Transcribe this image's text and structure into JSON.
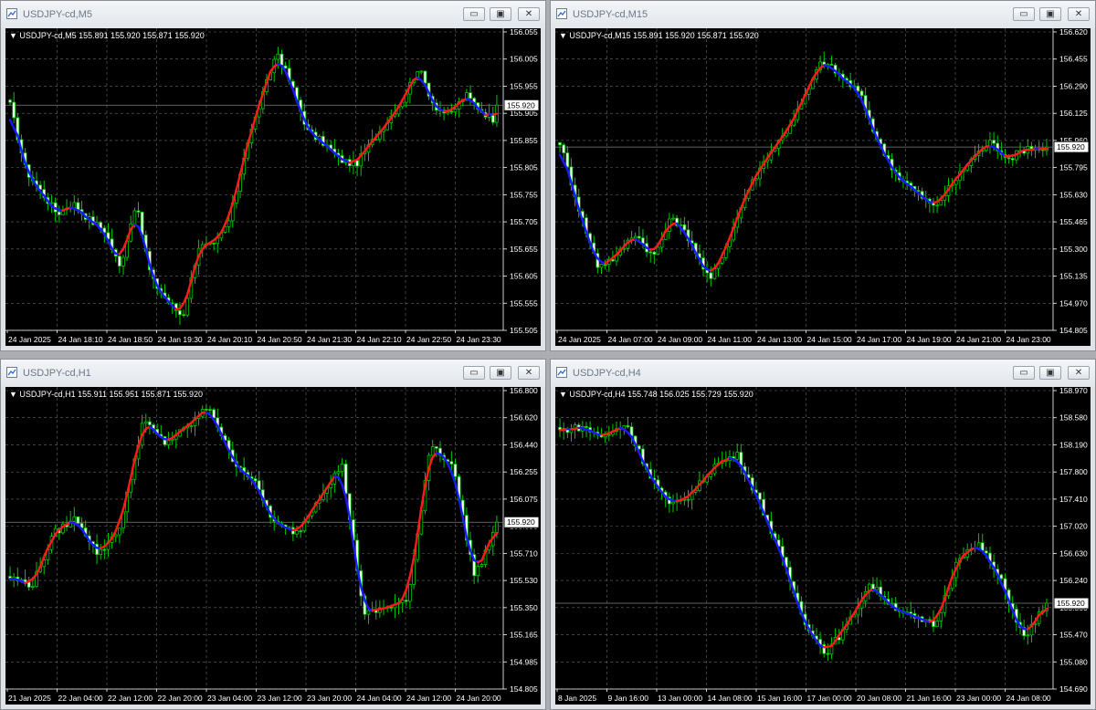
{
  "colors": {
    "bull": "#00c800",
    "bear": "#00c800",
    "up_line": "#ff1a1a",
    "down_line": "#1a1aff",
    "grid": "#6a6a6a",
    "axis_text": "#ffffff",
    "bid_line": "#808080"
  },
  "window_buttons": {
    "minimize": "▭",
    "maximize": "▣",
    "close": "✕"
  },
  "charts": [
    {
      "window_title": "USDJPY-cd,M5",
      "info": "▼ USDJPY-cd,M5  155.891 155.920 155.871 155.920",
      "price_label": "155.920",
      "y_ticks": [
        "156.055",
        "156.005",
        "155.955",
        "155.905",
        "155.855",
        "155.805",
        "155.755",
        "155.705",
        "155.655",
        "155.605",
        "155.555",
        "155.505"
      ],
      "x_ticks": [
        "24 Jan 2025",
        "24 Jan 18:10",
        "24 Jan 18:50",
        "24 Jan 19:30",
        "24 Jan 20:10",
        "24 Jan 20:50",
        "24 Jan 21:30",
        "24 Jan 22:10",
        "24 Jan 22:50",
        "24 Jan 23:30"
      ],
      "chart_data": {
        "type": "candlestick",
        "symbol": "USDJPY-cd",
        "timeframe": "M5",
        "last": 155.92,
        "ylim": [
          155.505,
          156.055
        ],
        "close": [
          155.92,
          155.8,
          155.76,
          155.72,
          155.74,
          155.71,
          155.69,
          155.62,
          155.74,
          155.6,
          155.56,
          155.53,
          155.66,
          155.66,
          155.71,
          155.84,
          155.93,
          156.02,
          155.95,
          155.87,
          155.85,
          155.82,
          155.81,
          155.85,
          155.89,
          155.93,
          155.99,
          155.92,
          155.9,
          155.94,
          155.91,
          155.89
        ]
      }
    },
    {
      "window_title": "USDJPY-cd,M15",
      "info": "▼ USDJPY-cd,M15  155.891 155.920 155.871 155.920",
      "price_label": "155.920",
      "y_ticks": [
        "156.620",
        "156.455",
        "156.290",
        "156.125",
        "155.960",
        "155.795",
        "155.630",
        "155.465",
        "155.300",
        "155.135",
        "154.970",
        "154.805"
      ],
      "x_ticks": [
        "24 Jan 2025",
        "24 Jan 07:00",
        "24 Jan 09:00",
        "24 Jan 11:00",
        "24 Jan 13:00",
        "24 Jan 15:00",
        "24 Jan 17:00",
        "24 Jan 19:00",
        "24 Jan 21:00",
        "24 Jan 23:00"
      ],
      "chart_data": {
        "type": "candlestick",
        "symbol": "USDJPY-cd",
        "timeframe": "M15",
        "last": 155.92,
        "ylim": [
          154.805,
          156.62
        ],
        "close": [
          155.95,
          155.55,
          155.2,
          155.25,
          155.4,
          155.25,
          155.5,
          155.35,
          155.1,
          155.35,
          155.65,
          155.85,
          156.0,
          156.2,
          156.45,
          156.35,
          156.25,
          155.95,
          155.75,
          155.65,
          155.55,
          155.7,
          155.85,
          155.95,
          155.85,
          155.92,
          155.9
        ]
      }
    },
    {
      "window_title": "USDJPY-cd,H1",
      "info": "▼ USDJPY-cd,H1  155.911 155.951 155.871 155.920",
      "price_label": "155.920",
      "y_ticks": [
        "156.800",
        "156.620",
        "156.440",
        "156.255",
        "156.075",
        "155.890",
        "155.710",
        "155.530",
        "155.350",
        "155.165",
        "154.985",
        "154.805"
      ],
      "x_ticks": [
        "21 Jan 2025",
        "22 Jan 04:00",
        "22 Jan 12:00",
        "22 Jan 20:00",
        "23 Jan 04:00",
        "23 Jan 12:00",
        "23 Jan 20:00",
        "24 Jan 04:00",
        "24 Jan 12:00",
        "24 Jan 20:00"
      ],
      "chart_data": {
        "type": "candlestick",
        "symbol": "USDJPY-cd",
        "timeframe": "H1",
        "last": 155.92,
        "ylim": [
          154.805,
          156.8
        ],
        "close": [
          155.55,
          155.5,
          155.85,
          155.95,
          155.7,
          155.9,
          156.6,
          156.45,
          156.55,
          156.7,
          156.35,
          156.2,
          155.9,
          155.85,
          156.1,
          156.3,
          155.3,
          155.35,
          155.4,
          156.45,
          156.3,
          155.55,
          155.9
        ]
      }
    },
    {
      "window_title": "USDJPY-cd,H4",
      "info": "▼ USDJPY-cd,H4  155.748 156.025 155.729 155.920",
      "price_label": "155.920",
      "y_ticks": [
        "158.970",
        "158.580",
        "158.190",
        "157.800",
        "157.410",
        "157.020",
        "156.630",
        "156.240",
        "155.860",
        "155.470",
        "155.080",
        "154.690"
      ],
      "x_ticks": [
        "8 Jan 2025",
        "9 Jan 16:00",
        "13 Jan 00:00",
        "14 Jan 08:00",
        "15 Jan 16:00",
        "17 Jan 00:00",
        "20 Jan 08:00",
        "21 Jan 16:00",
        "23 Jan 00:00",
        "24 Jan 08:00"
      ],
      "chart_data": {
        "type": "candlestick",
        "symbol": "USDJPY-cd",
        "timeframe": "H4",
        "last": 155.92,
        "ylim": [
          154.69,
          158.97
        ],
        "close": [
          158.4,
          158.45,
          158.3,
          158.5,
          157.8,
          157.3,
          157.5,
          157.9,
          158.05,
          157.4,
          156.6,
          155.7,
          155.2,
          155.6,
          156.2,
          155.9,
          155.7,
          155.6,
          156.6,
          156.75,
          156.2,
          155.4,
          155.95
        ]
      }
    }
  ]
}
